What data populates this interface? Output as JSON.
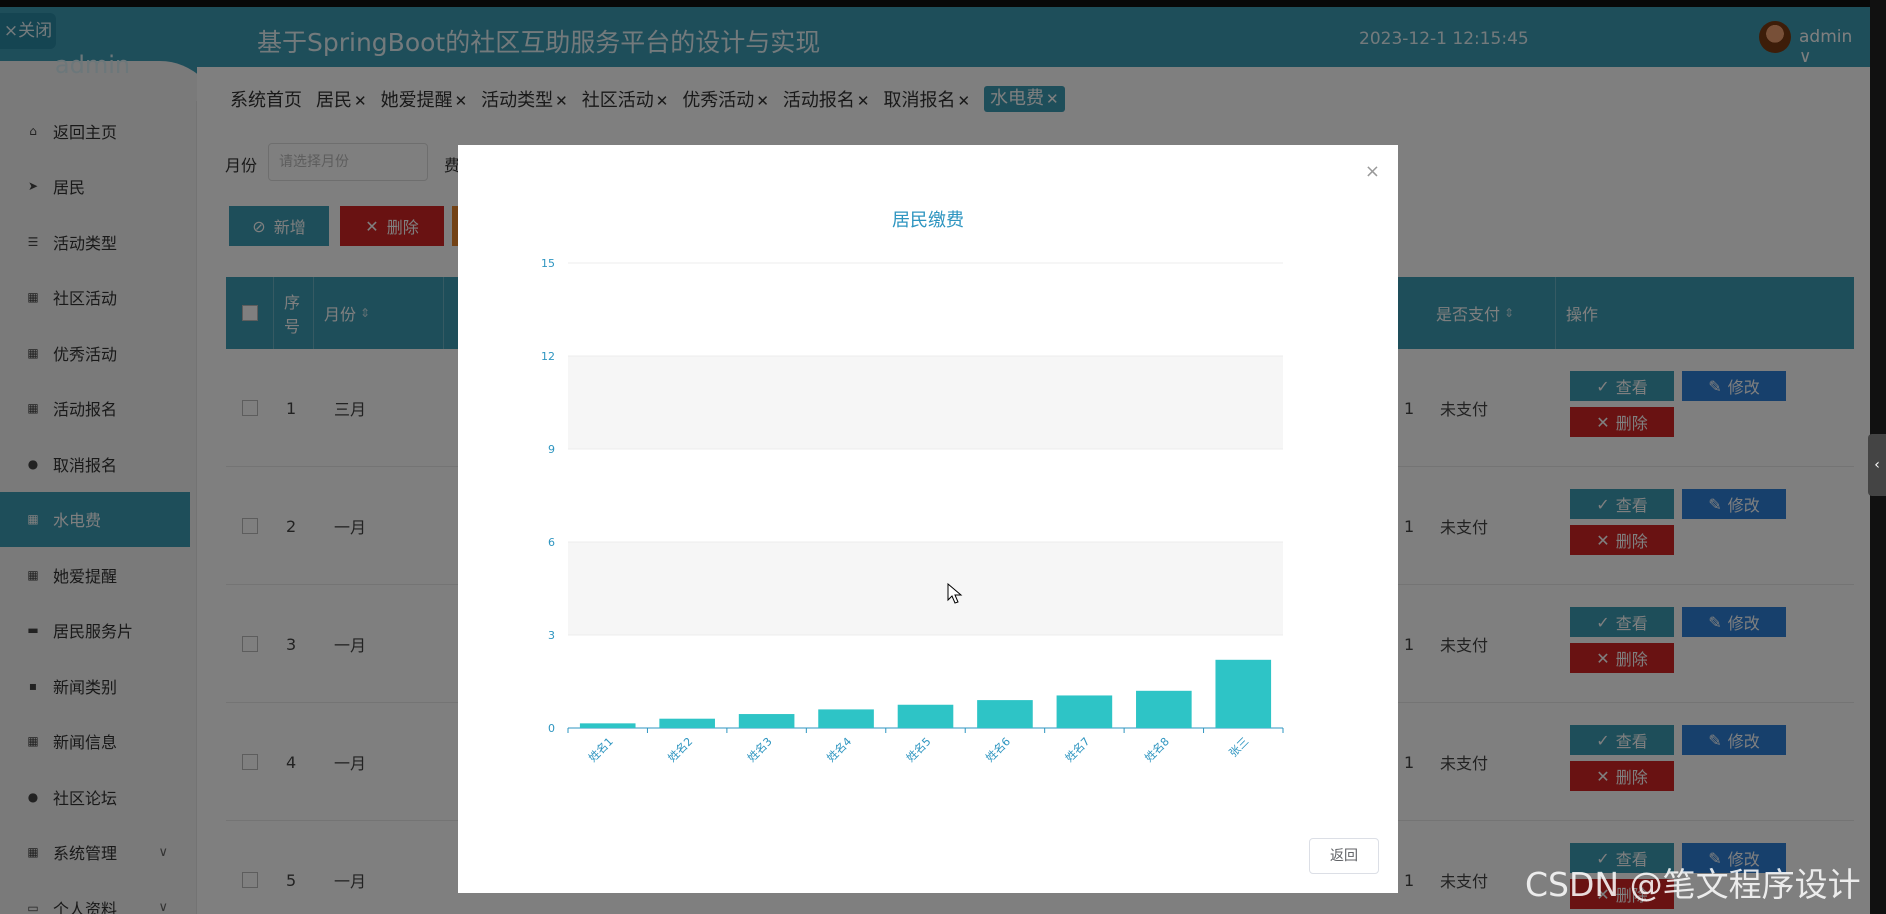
{
  "sidebar": {
    "close_label": "×关闭",
    "user": "admin",
    "items": [
      {
        "label": "返回主页",
        "icon": "home-icon"
      },
      {
        "label": "居民",
        "icon": "send-icon"
      },
      {
        "label": "活动类型",
        "icon": "list-icon"
      },
      {
        "label": "社区活动",
        "icon": "grid-icon"
      },
      {
        "label": "优秀活动",
        "icon": "grid-icon"
      },
      {
        "label": "活动报名",
        "icon": "grid-icon"
      },
      {
        "label": "取消报名",
        "icon": "user-icon"
      },
      {
        "label": "水电费",
        "icon": "grid-icon",
        "active": true
      },
      {
        "label": "她爱提醒",
        "icon": "grid-icon"
      },
      {
        "label": "居民服务片",
        "icon": "message-icon"
      },
      {
        "label": "新闻类别",
        "icon": "print-icon"
      },
      {
        "label": "新闻信息",
        "icon": "grid-icon"
      },
      {
        "label": "社区论坛",
        "icon": "user-icon"
      },
      {
        "label": "系统管理",
        "icon": "grid-icon",
        "has_arrow": true
      },
      {
        "label": "个人资料",
        "icon": "card-icon",
        "has_arrow": true
      }
    ]
  },
  "header": {
    "title": "基于SpringBoot的社区互助服务平台的设计与实现",
    "datetime": "2023-12-1 12:15:45",
    "user": "admin"
  },
  "tabs": [
    {
      "label": "系统首页",
      "closable": false
    },
    {
      "label": "居民",
      "closable": true
    },
    {
      "label": "她爱提醒",
      "closable": true
    },
    {
      "label": "活动类型",
      "closable": true
    },
    {
      "label": "社区活动",
      "closable": true
    },
    {
      "label": "优秀活动",
      "closable": true
    },
    {
      "label": "活动报名",
      "closable": true
    },
    {
      "label": "取消报名",
      "closable": true
    },
    {
      "label": "水电费",
      "closable": true,
      "active": true
    }
  ],
  "search": {
    "month_label": "月份",
    "month_placeholder": "请选择月份",
    "fee_label": "费"
  },
  "toolbar": {
    "add_label": "新增",
    "delete_label": "删除"
  },
  "table": {
    "headers": {
      "seq": "序号",
      "month": "月份",
      "paid": "是否支付",
      "actions": "操作"
    },
    "rows": [
      {
        "seq": "1",
        "month": "三月",
        "col": "1",
        "paid": "未支付"
      },
      {
        "seq": "2",
        "month": "一月",
        "col": "1",
        "paid": "未支付"
      },
      {
        "seq": "3",
        "month": "一月",
        "col": "1",
        "paid": "未支付"
      },
      {
        "seq": "4",
        "month": "一月",
        "col": "1",
        "paid": "未支付"
      },
      {
        "seq": "5",
        "month": "一月",
        "col": "1",
        "paid": "未支付"
      }
    ],
    "view_label": "查看",
    "edit_label": "修改",
    "delete_label": "删除"
  },
  "modal": {
    "close": "×",
    "return_label": "返回"
  },
  "chart_data": {
    "type": "bar",
    "title": "居民缴费",
    "categories": [
      "姓名1",
      "姓名2",
      "姓名3",
      "姓名4",
      "姓名5",
      "姓名6",
      "姓名7",
      "姓名8",
      "张三"
    ],
    "values": [
      0.15,
      0.3,
      0.45,
      0.6,
      0.75,
      0.9,
      1.05,
      1.2,
      2.2
    ],
    "ylim": [
      0,
      15
    ],
    "yticks": [
      0,
      3,
      6,
      9,
      12,
      15
    ],
    "bar_color": "#2ec4c6",
    "axis_color": "#2e95c0",
    "grid": true
  },
  "watermark": "CSDN @笔文程序设计",
  "colors": {
    "primary": "#3d9cb5",
    "danger": "#d32424",
    "edit": "#2e80d8"
  }
}
